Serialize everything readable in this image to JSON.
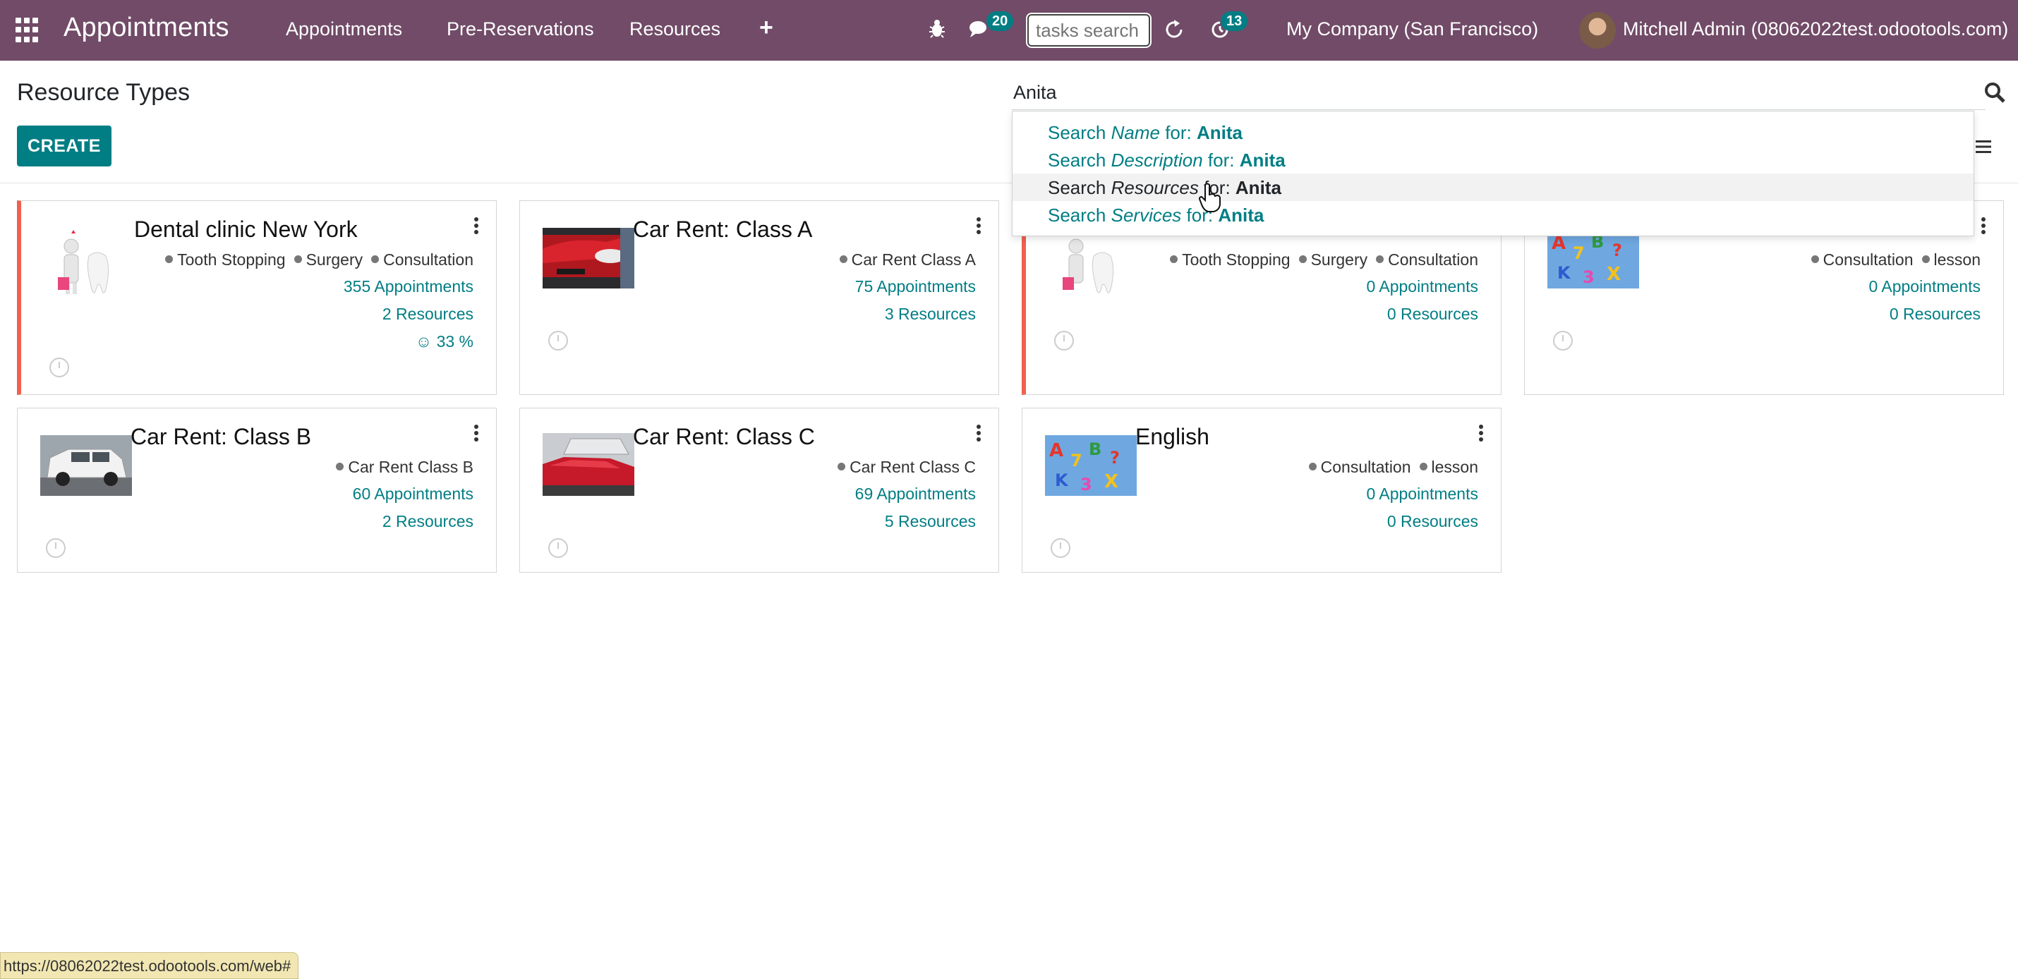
{
  "navbar": {
    "brand": "Appointments",
    "menu": [
      "Appointments",
      "Pre-Reservations",
      "Resources"
    ],
    "messages_count": "20",
    "activities_count": "13",
    "tasks_search_placeholder": "tasks search",
    "company": "My Company (San Francisco)",
    "user": "Mitchell Admin (08062022test.odootools.com)"
  },
  "control_panel": {
    "title": "Resource Types",
    "create_label": "CREATE",
    "search_value": "Anita"
  },
  "autocomplete": [
    {
      "prefix": "Search ",
      "field": "Name",
      "mid": " for: ",
      "term": "Anita"
    },
    {
      "prefix": "Search ",
      "field": "Description",
      "mid": " for: ",
      "term": "Anita"
    },
    {
      "prefix": "Search ",
      "field": "Resources",
      "mid": " for: ",
      "term": "Anita"
    },
    {
      "prefix": "Search ",
      "field": "Services",
      "mid": " for: ",
      "term": "Anita"
    }
  ],
  "cards": [
    {
      "title": "Dental clinic New York",
      "tags": [
        "Tooth Stopping",
        "Surgery",
        "Consultation"
      ],
      "appointments": "355 Appointments",
      "resources": "2 Resources",
      "rate": "33 %"
    },
    {
      "title": "Car Rent: Class A",
      "tags": [
        "Car Rent Class A"
      ],
      "appointments": "75 Appointments",
      "resources": "3 Resources"
    },
    {
      "title": "",
      "tags": [
        "Tooth Stopping",
        "Surgery",
        "Consultation"
      ],
      "appointments": "0 Appointments",
      "resources": "0 Resources"
    },
    {
      "title": "",
      "tags": [
        "Consultation",
        "lesson"
      ],
      "appointments": "0 Appointments",
      "resources": "0 Resources"
    },
    {
      "title": "Car Rent: Class B",
      "tags": [
        "Car Rent Class B"
      ],
      "appointments": "60 Appointments",
      "resources": "2 Resources"
    },
    {
      "title": "Car Rent: Class C",
      "tags": [
        "Car Rent Class C"
      ],
      "appointments": "69 Appointments",
      "resources": "5 Resources"
    },
    {
      "title": "English",
      "tags": [
        "Consultation",
        "lesson"
      ],
      "appointments": "0 Appointments",
      "resources": "0 Resources"
    }
  ],
  "status_url": "https://08062022test.odootools.com/web#",
  "colors": {
    "navbar": "#714b67",
    "primary": "#017e84",
    "card_alert": "#f06050"
  }
}
